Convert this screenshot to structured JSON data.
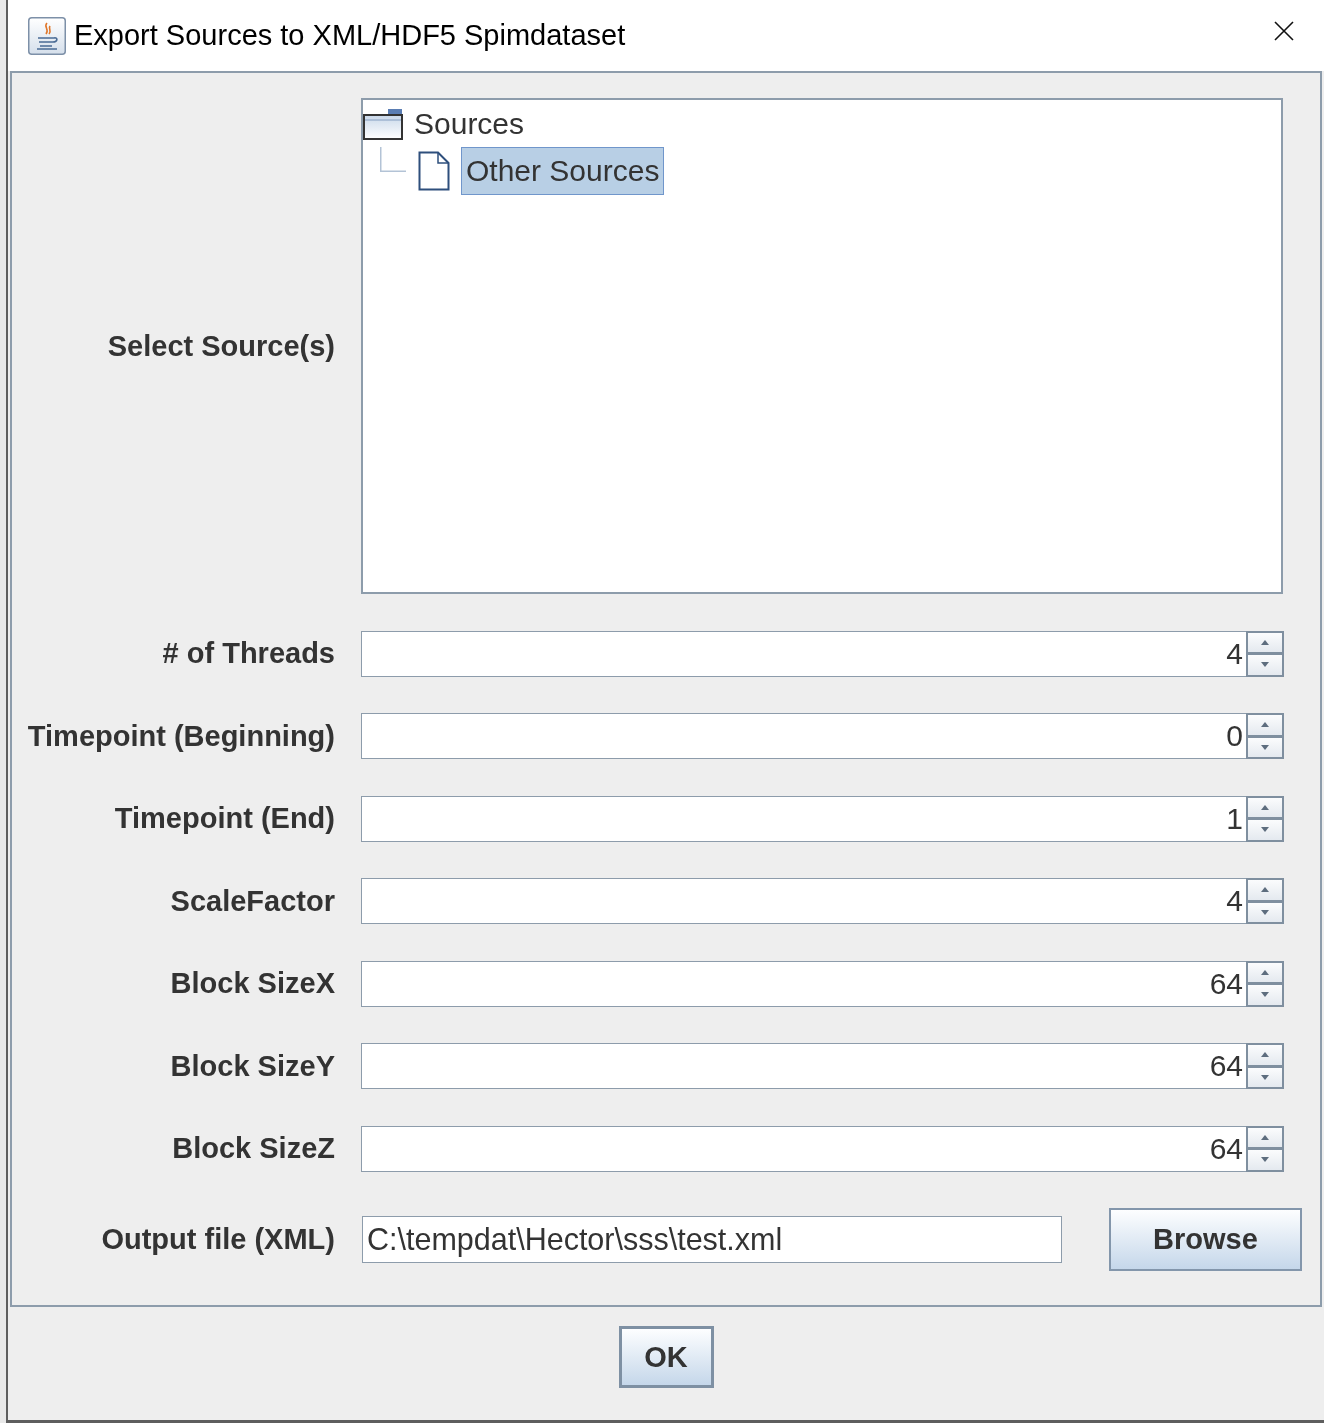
{
  "window": {
    "title": "Export Sources to XML/HDF5 Spimdataset"
  },
  "source_selector": {
    "label": "Select Source(s)",
    "tree": [
      {
        "label": "Sources",
        "kind": "folder",
        "selected": false,
        "children": [
          {
            "label": "Other Sources",
            "kind": "file",
            "selected": true
          }
        ]
      }
    ]
  },
  "spinners": [
    {
      "label": "# of Threads",
      "value": "4"
    },
    {
      "label": "Timepoint (Beginning)",
      "value": "0"
    },
    {
      "label": "Timepoint (End)",
      "value": "1"
    },
    {
      "label": "ScaleFactor",
      "value": "4"
    },
    {
      "label": "Block SizeX",
      "value": "64"
    },
    {
      "label": "Block SizeY",
      "value": "64"
    },
    {
      "label": "Block SizeZ",
      "value": "64"
    }
  ],
  "output_file": {
    "label": "Output file (XML)",
    "value": "C:\\tempdat\\Hector\\sss\\test.xml",
    "button": "Browse"
  },
  "buttons": [
    "OK"
  ]
}
